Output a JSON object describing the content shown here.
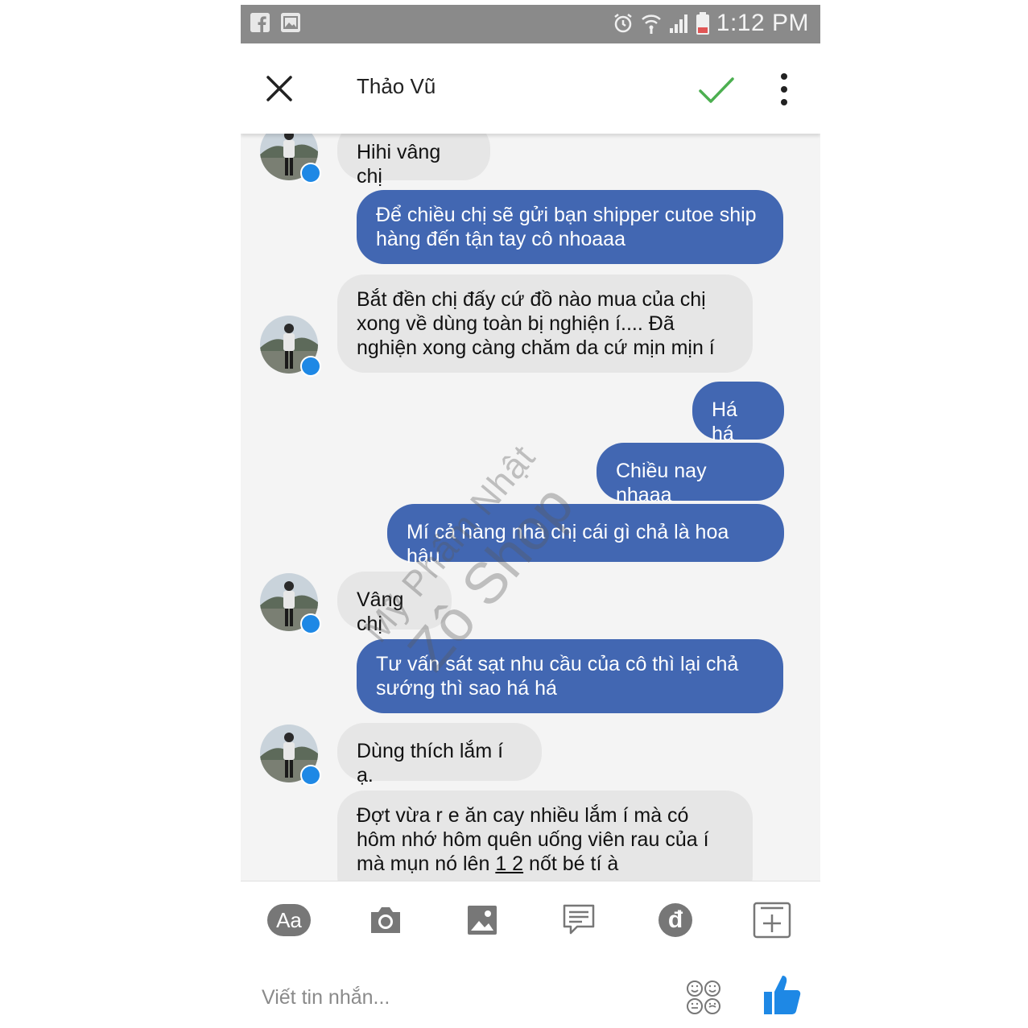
{
  "status_bar": {
    "time": "1:12 PM",
    "left_icons": [
      "facebook-icon",
      "gallery-icon"
    ],
    "right_icons": [
      "alarm-icon",
      "wifi-icon",
      "signal-icon",
      "battery-icon"
    ]
  },
  "header": {
    "title": "Thảo Vũ",
    "close_icon": "close-icon",
    "confirm_icon": "checkmark-icon",
    "menu_icon": "more-vertical-icon"
  },
  "messages": [
    {
      "side": "in",
      "text": "Hihi vâng chị"
    },
    {
      "side": "out",
      "text": "Để chiều chị sẽ gửi bạn shipper cutoe ship hàng đến tận tay cô nhoaaa"
    },
    {
      "side": "in",
      "text": "Bắt đền chị đấy cứ đồ nào mua của chị xong về dùng toàn bị nghiện í.... Đã nghiện xong càng chăm da cứ mịn mịn í"
    },
    {
      "side": "out",
      "text": "Há há"
    },
    {
      "side": "out",
      "text": "Chiều nay nhaaa"
    },
    {
      "side": "out",
      "text": "Mí cả hàng nhà chị cái gì chả là hoa hậu"
    },
    {
      "side": "in",
      "text": "Vâng chị"
    },
    {
      "side": "out",
      "text": "Tư vấn sát sạt nhu cầu của cô thì lại chả sướng thì sao há há"
    },
    {
      "side": "in",
      "text": "Dùng thích lắm í ạ."
    },
    {
      "side": "in",
      "text_parts": [
        "Đợt vừa r e ăn cay nhiều lắm í mà có hôm nhớ hôm quên uống viên rau của í mà mụn nó lên ",
        "1 2",
        " nốt bé tí à"
      ]
    }
  ],
  "watermark": {
    "line1": "Mỹ Phẩm Nhật",
    "line2": "Zô Shop"
  },
  "toolbar": {
    "text_button": "Aa",
    "currency_symbol": "đ",
    "icons": [
      "text-format-icon",
      "camera-icon",
      "image-icon",
      "sticker-message-icon",
      "payment-icon",
      "more-plus-icon"
    ]
  },
  "composer": {
    "placeholder": "Viết tin nhắn...",
    "emoji_icon": "emoji-icon",
    "like_icon": "thumbs-up-icon"
  },
  "colors": {
    "outgoing_bubble": "#4267b2",
    "incoming_bubble": "#e6e6e6",
    "accent_blue": "#1e88e5",
    "check_green": "#4caf50"
  }
}
